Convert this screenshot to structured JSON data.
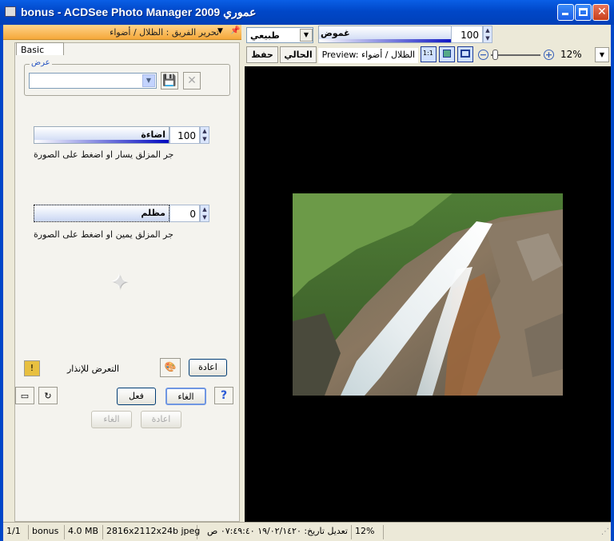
{
  "window": {
    "title": "bonus - ACDSee Photo Manager 2009 عموري"
  },
  "panel": {
    "title": "تحرير الفريق : الظلال / أضواء",
    "tab": "Basic",
    "preset": {
      "label": "عرض",
      "value": ""
    },
    "lighten": {
      "label": "اضاءة",
      "value": "100",
      "fill": 1.0,
      "hint": "جر المزلق يسار او اضغط على الصورة"
    },
    "darken": {
      "label": "مظلم",
      "value": "0",
      "fill": 0.0,
      "hint": "جر المزلق يمين او اضغط على الصورة"
    },
    "exposure_label": "التعرض للإنذار",
    "reset_label": "اعادة",
    "cancel_label": "الغاء",
    "apply_label": "فعل",
    "undo_label": "الغاء",
    "redo_label": "اعادة"
  },
  "toolbar": {
    "mode": "طبيعي",
    "blend_label": "غموض",
    "blend_value": "100",
    "save_label": "حفظ",
    "current_label": "الحالي",
    "preview_label": "Preview: الظلال / أضواء",
    "zoom": "12%"
  },
  "status": {
    "index": "1/1",
    "name": "bonus",
    "size": "4.0 MB",
    "dims": "2816x2112x24b jpeg",
    "modified": "تعديل تاريخ: ١٩/٠٢/١٤٢٠ ٠٧:٤٩:٤٠ ص",
    "zoom": "12%"
  },
  "colors": {
    "accent": "#0047c8",
    "panel_head": "#f5a83a"
  }
}
